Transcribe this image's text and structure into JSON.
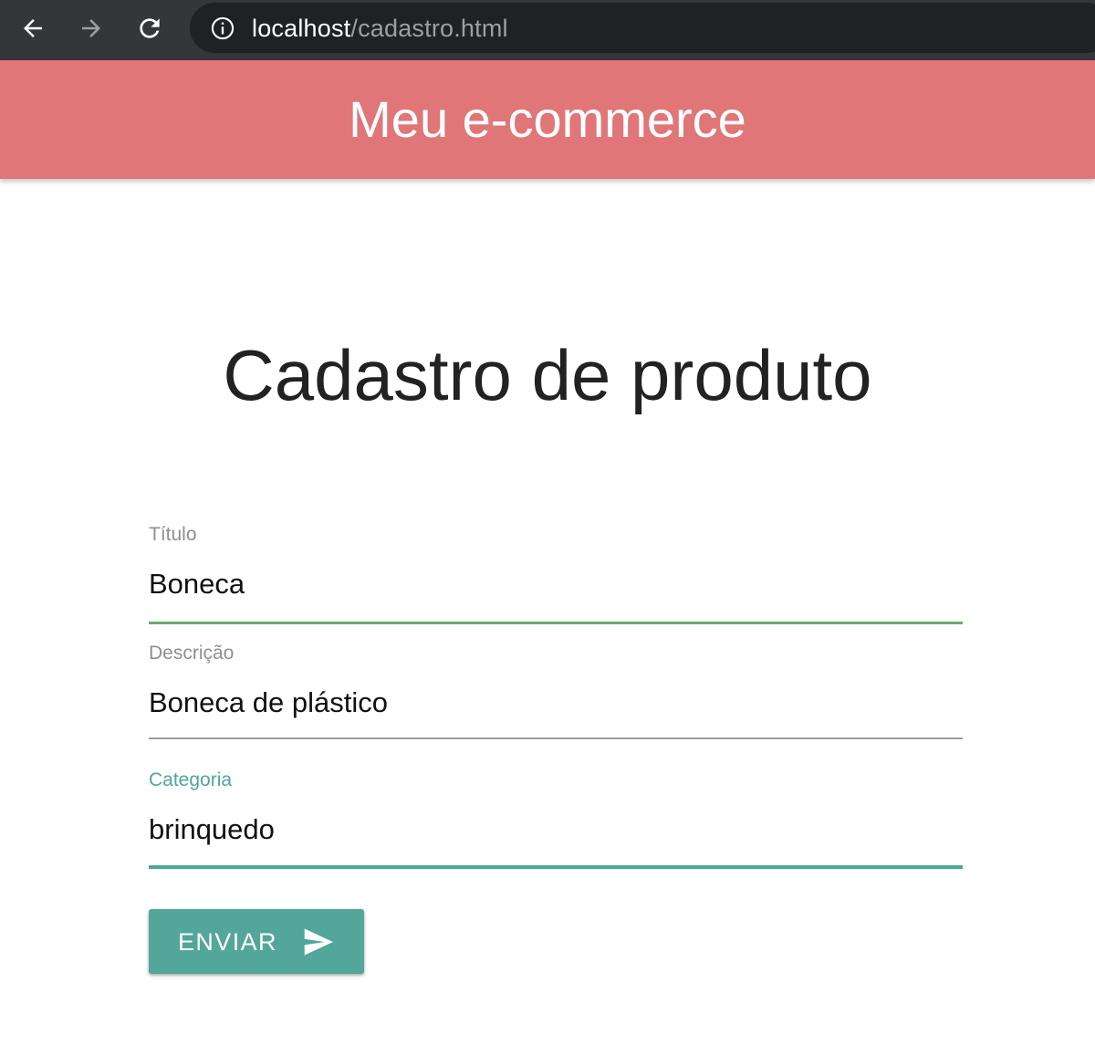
{
  "browser": {
    "url_host": "localhost",
    "url_path": "/cadastro.html",
    "icons": {
      "back": "arrow-left-icon",
      "forward": "arrow-right-icon",
      "reload": "reload-icon",
      "info": "info-icon"
    }
  },
  "header": {
    "title": "Meu e-commerce",
    "background_color": "#e07678"
  },
  "main": {
    "page_title": "Cadastro de produto",
    "form": {
      "fields": [
        {
          "label": "Título",
          "value": "Boneca"
        },
        {
          "label": "Descrição",
          "value": "Boneca de plástico"
        },
        {
          "label": "Categoria",
          "value": "brinquedo"
        }
      ],
      "submit_label": "ENVIAR",
      "submit_icon": "send-icon"
    }
  },
  "colors": {
    "accent": "#53a69a",
    "focused_label": "#4fa59c",
    "valid_underline": "#6aaa6c",
    "default_underline": "#9e9e9e"
  }
}
